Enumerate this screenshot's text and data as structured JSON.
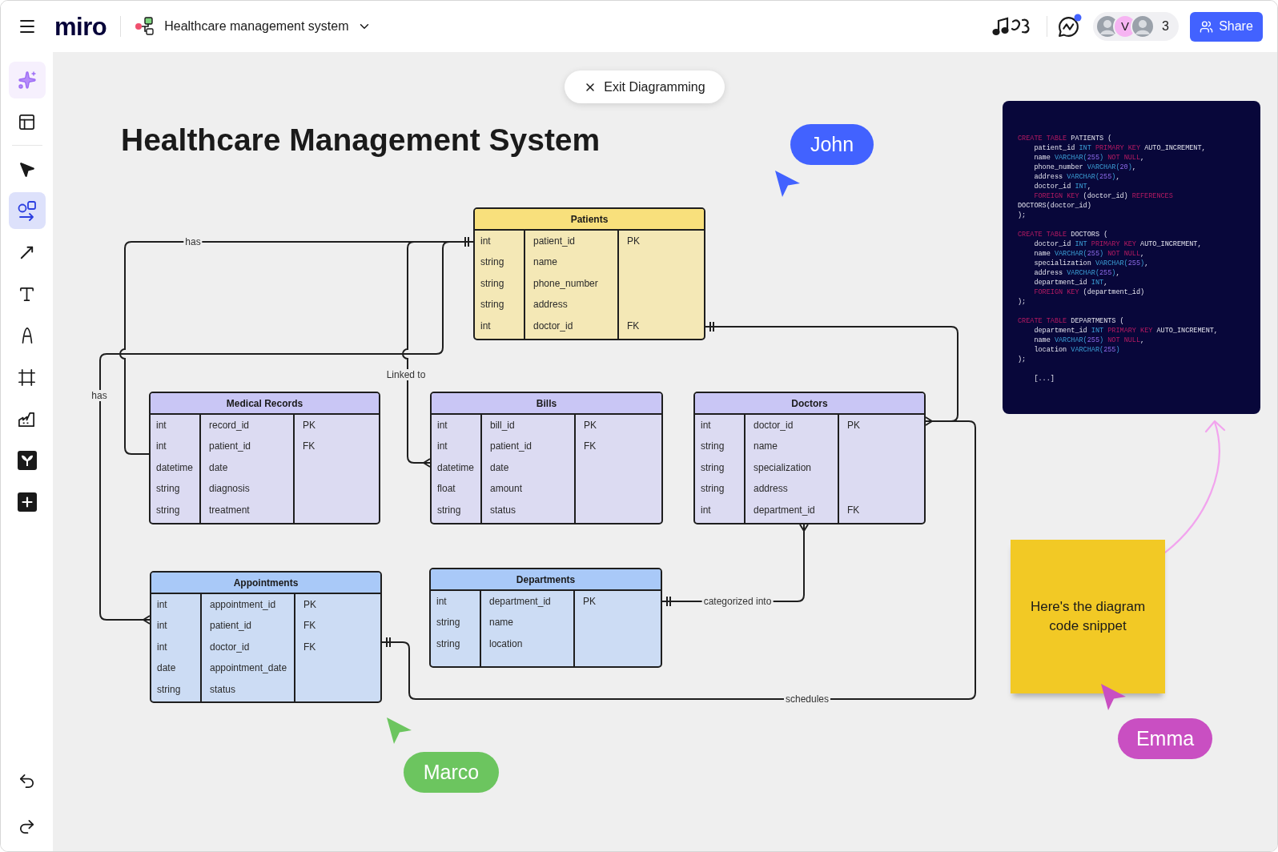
{
  "top_bar": {
    "logo": "miro",
    "board_title": "Healthcare management system",
    "avatars": [
      {
        "kind": "photo"
      },
      {
        "kind": "initial",
        "initial": "V"
      },
      {
        "kind": "photo"
      }
    ],
    "collaborator_count": "3",
    "share_button": "Share"
  },
  "toolbar": {
    "tools": [
      {
        "kind": "ai",
        "selected": false
      },
      {
        "kind": "templates",
        "selected": false
      },
      {
        "kind": "select",
        "selected": false
      },
      {
        "kind": "shapes",
        "selected": true
      },
      {
        "kind": "connector",
        "selected": false
      },
      {
        "kind": "text",
        "selected": false
      },
      {
        "kind": "pen",
        "selected": false
      },
      {
        "kind": "frame",
        "selected": false
      },
      {
        "kind": "chart",
        "selected": false
      },
      {
        "kind": "app",
        "selected": false
      },
      {
        "kind": "more",
        "selected": false
      }
    ],
    "history": [
      {
        "kind": "undo"
      },
      {
        "kind": "redo"
      }
    ]
  },
  "canvas": {
    "exit_button": "Exit Diagramming",
    "title": "Healthcare Management System",
    "tables": [
      {
        "name": "Patients",
        "color": "#f8e07c",
        "rows": [
          {
            "type": "int",
            "field": "patient_id",
            "key": "PK"
          },
          {
            "type": "string",
            "field": "name"
          },
          {
            "type": "string",
            "field": "phone_number"
          },
          {
            "type": "string",
            "field": "address"
          },
          {
            "type": "int",
            "field": "doctor_id",
            "key": "FK"
          }
        ]
      },
      {
        "name": "Medical Records",
        "color": "#c9c6f5",
        "rows": [
          {
            "type": "int",
            "field": "record_id",
            "key": "PK"
          },
          {
            "type": "int",
            "field": "patient_id",
            "key": "FK"
          },
          {
            "type": "datetime",
            "field": "date"
          },
          {
            "type": "string",
            "field": "diagnosis"
          },
          {
            "type": "string",
            "field": "treatment"
          }
        ]
      },
      {
        "name": "Bills",
        "color": "#c9c6f5",
        "rows": [
          {
            "type": "int",
            "field": "bill_id",
            "key": "PK"
          },
          {
            "type": "int",
            "field": "patient_id",
            "key": "FK"
          },
          {
            "type": "datetime",
            "field": "date"
          },
          {
            "type": "float",
            "field": "amount"
          },
          {
            "type": "string",
            "field": "status"
          }
        ]
      },
      {
        "name": "Doctors",
        "color": "#c9c6f5",
        "rows": [
          {
            "type": "int",
            "field": "doctor_id",
            "key": "PK"
          },
          {
            "type": "string",
            "field": "name"
          },
          {
            "type": "string",
            "field": "specialization"
          },
          {
            "type": "string",
            "field": "address"
          },
          {
            "type": "int",
            "field": "department_id",
            "key": "FK"
          }
        ]
      },
      {
        "name": "Appointments",
        "color": "#a9c9f8",
        "rows": [
          {
            "type": "int",
            "field": "appointment_id",
            "key": "PK"
          },
          {
            "type": "int",
            "field": "patient_id",
            "key": "FK"
          },
          {
            "type": "int",
            "field": "doctor_id",
            "key": "FK"
          },
          {
            "type": "date",
            "field": "appointment_date"
          },
          {
            "type": "string",
            "field": "status"
          }
        ]
      },
      {
        "name": "Departments",
        "color": "#a9c9f8",
        "rows": [
          {
            "type": "int",
            "field": "department_id",
            "key": "PK"
          },
          {
            "type": "string",
            "field": "name"
          },
          {
            "type": "string",
            "field": "location"
          }
        ]
      }
    ],
    "connectors": [
      {
        "label": "has"
      },
      {
        "label": "Linked to"
      },
      {
        "label": "has"
      },
      {
        "label": "categorized into"
      },
      {
        "label": "schedules"
      }
    ],
    "code_snippet": {
      "blocks": [
        {
          "lines": [
            {
              "indent": false,
              "tokens": [
                {
                  "kind": "keyword",
                  "text": "CREATE TABLE"
                },
                {
                  "kind": "plain",
                  "text": " PATIENTS ("
                }
              ]
            },
            {
              "indent": true,
              "tokens": [
                {
                  "kind": "plain",
                  "text": "patient_id "
                },
                {
                  "kind": "type",
                  "text": "INT"
                },
                {
                  "kind": "keyword",
                  "text": " PRIMARY KEY"
                },
                {
                  "kind": "plain",
                  "text": " AUTO_INCREMENT,"
                }
              ]
            },
            {
              "indent": true,
              "tokens": [
                {
                  "kind": "plain",
                  "text": "name "
                },
                {
                  "kind": "type",
                  "text": "VARCHAR("
                },
                {
                  "kind": "number",
                  "text": "255"
                },
                {
                  "kind": "type",
                  "text": ")"
                },
                {
                  "kind": "keyword",
                  "text": " NOT NULL"
                },
                {
                  "kind": "plain",
                  "text": ","
                }
              ]
            },
            {
              "indent": true,
              "tokens": [
                {
                  "kind": "plain",
                  "text": "phone_number "
                },
                {
                  "kind": "type",
                  "text": "VARCHAR("
                },
                {
                  "kind": "number",
                  "text": "20"
                },
                {
                  "kind": "type",
                  "text": ")"
                },
                {
                  "kind": "plain",
                  "text": ","
                }
              ]
            },
            {
              "indent": true,
              "tokens": [
                {
                  "kind": "plain",
                  "text": "address "
                },
                {
                  "kind": "type",
                  "text": "VARCHAR("
                },
                {
                  "kind": "number",
                  "text": "255"
                },
                {
                  "kind": "type",
                  "text": ")"
                },
                {
                  "kind": "plain",
                  "text": ","
                }
              ]
            },
            {
              "indent": true,
              "tokens": [
                {
                  "kind": "plain",
                  "text": "doctor_id "
                },
                {
                  "kind": "type",
                  "text": "INT"
                },
                {
                  "kind": "plain",
                  "text": ","
                }
              ]
            },
            {
              "indent": true,
              "tokens": [
                {
                  "kind": "keyword",
                  "text": "FOREIGN KEY"
                },
                {
                  "kind": "plain",
                  "text": " (doctor_id) "
                },
                {
                  "kind": "keyword",
                  "text": "REFERENCES"
                }
              ]
            },
            {
              "indent": false,
              "tokens": [
                {
                  "kind": "plain",
                  "text": "DOCTORS(doctor_id)"
                }
              ]
            },
            {
              "indent": false,
              "tokens": [
                {
                  "kind": "plain",
                  "text": ");"
                }
              ]
            }
          ]
        },
        {
          "lines": [
            {
              "indent": false,
              "tokens": [
                {
                  "kind": "keyword",
                  "text": "CREATE TABLE"
                },
                {
                  "kind": "plain",
                  "text": " DOCTORS ("
                }
              ]
            },
            {
              "indent": true,
              "tokens": [
                {
                  "kind": "plain",
                  "text": "doctor_id "
                },
                {
                  "kind": "type",
                  "text": "INT"
                },
                {
                  "kind": "keyword",
                  "text": " PRIMARY KEY"
                },
                {
                  "kind": "plain",
                  "text": " AUTO_INCREMENT,"
                }
              ]
            },
            {
              "indent": true,
              "tokens": [
                {
                  "kind": "plain",
                  "text": "name "
                },
                {
                  "kind": "type",
                  "text": "VARCHAR("
                },
                {
                  "kind": "number",
                  "text": "255"
                },
                {
                  "kind": "type",
                  "text": ")"
                },
                {
                  "kind": "keyword",
                  "text": " NOT NULL"
                },
                {
                  "kind": "plain",
                  "text": ","
                }
              ]
            },
            {
              "indent": true,
              "tokens": [
                {
                  "kind": "plain",
                  "text": "specialization "
                },
                {
                  "kind": "type",
                  "text": "VARCHAR("
                },
                {
                  "kind": "number",
                  "text": "255"
                },
                {
                  "kind": "type",
                  "text": ")"
                },
                {
                  "kind": "plain",
                  "text": ","
                }
              ]
            },
            {
              "indent": true,
              "tokens": [
                {
                  "kind": "plain",
                  "text": "address "
                },
                {
                  "kind": "type",
                  "text": "VARCHAR("
                },
                {
                  "kind": "number",
                  "text": "255"
                },
                {
                  "kind": "type",
                  "text": ")"
                },
                {
                  "kind": "plain",
                  "text": ","
                }
              ]
            },
            {
              "indent": true,
              "tokens": [
                {
                  "kind": "plain",
                  "text": "department_id "
                },
                {
                  "kind": "type",
                  "text": "INT"
                },
                {
                  "kind": "plain",
                  "text": ","
                }
              ]
            },
            {
              "indent": true,
              "tokens": [
                {
                  "kind": "keyword",
                  "text": "FOREIGN KEY"
                },
                {
                  "kind": "plain",
                  "text": " (department_id)"
                }
              ]
            },
            {
              "indent": false,
              "tokens": [
                {
                  "kind": "plain",
                  "text": ");"
                }
              ]
            }
          ]
        },
        {
          "lines": [
            {
              "indent": false,
              "tokens": [
                {
                  "kind": "keyword",
                  "text": "CREATE TABLE"
                },
                {
                  "kind": "plain",
                  "text": " DEPARTMENTS ("
                }
              ]
            },
            {
              "indent": true,
              "tokens": [
                {
                  "kind": "plain",
                  "text": "department_id "
                },
                {
                  "kind": "type",
                  "text": "INT"
                },
                {
                  "kind": "keyword",
                  "text": " PRIMARY KEY"
                },
                {
                  "kind": "plain",
                  "text": " AUTO_INCREMENT,"
                }
              ]
            },
            {
              "indent": true,
              "tokens": [
                {
                  "kind": "plain",
                  "text": "name "
                },
                {
                  "kind": "type",
                  "text": "VARCHAR("
                },
                {
                  "kind": "number",
                  "text": "255"
                },
                {
                  "kind": "type",
                  "text": ")"
                },
                {
                  "kind": "keyword",
                  "text": " NOT NULL"
                },
                {
                  "kind": "plain",
                  "text": ","
                }
              ]
            },
            {
              "indent": true,
              "tokens": [
                {
                  "kind": "plain",
                  "text": "location "
                },
                {
                  "kind": "type",
                  "text": "VARCHAR("
                },
                {
                  "kind": "number",
                  "text": "255"
                },
                {
                  "kind": "type",
                  "text": ")"
                }
              ]
            },
            {
              "indent": false,
              "tokens": [
                {
                  "kind": "plain",
                  "text": ");"
                }
              ]
            }
          ]
        },
        {
          "lines": [
            {
              "indent": true,
              "tokens": [
                {
                  "kind": "plain",
                  "text": "[...]"
                }
              ]
            }
          ]
        }
      ]
    },
    "sticky_note": "Here's the diagram code snippet",
    "cursors": [
      {
        "name": "John",
        "color": "#4262ff"
      },
      {
        "name": "Emma",
        "color": "#c94fc2"
      },
      {
        "name": "Marco",
        "color": "#6cc55f"
      }
    ]
  }
}
